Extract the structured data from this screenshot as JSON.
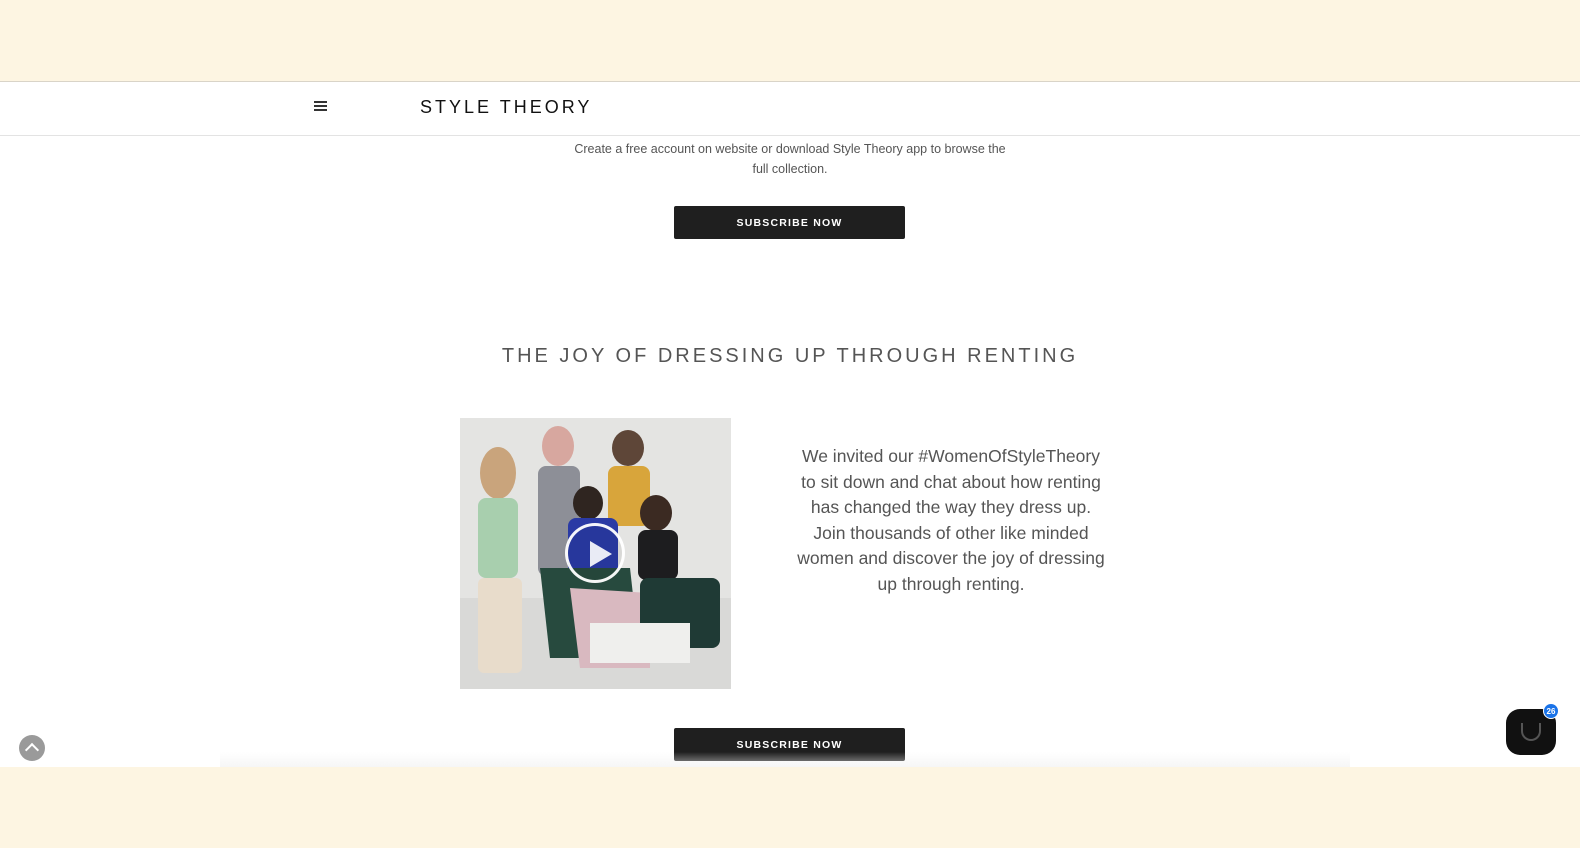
{
  "header": {
    "brand": "STYLE THEORY"
  },
  "intro": {
    "text": "Create a free account on website or download Style Theory app to browse the full collection.",
    "subscribe_label": "SUBSCRIBE NOW"
  },
  "joy_section": {
    "title": "THE JOY OF DRESSING UP THROUGH RENTING",
    "description": "We invited our #WomenOfStyleTheory to sit down and chat about how renting has changed the way they dress up. Join thousands of other like minded women and discover the joy of dressing up through renting.",
    "subscribe_label": "SUBSCRIBE NOW"
  },
  "chat": {
    "badge_count": "26"
  },
  "colors": {
    "banner": "#fdf5e2",
    "button": "#1f1f1f",
    "badge": "#1a73e8"
  }
}
